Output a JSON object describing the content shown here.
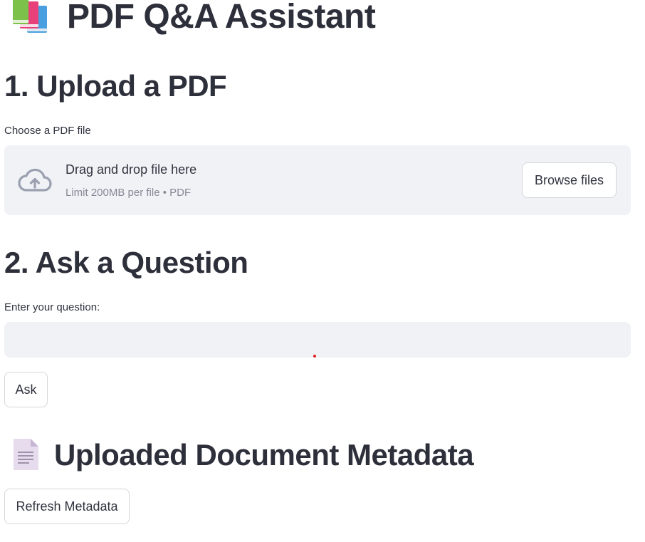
{
  "header": {
    "title": "PDF Q&A Assistant",
    "icon": "books-icon"
  },
  "upload": {
    "heading": "1. Upload a PDF",
    "label": "Choose a PDF file",
    "drop_text": "Drag and drop file here",
    "limit_text": "Limit 200MB per file • PDF",
    "browse_label": "Browse files",
    "icon": "cloud-upload-icon"
  },
  "question": {
    "heading": "2. Ask a Question",
    "label": "Enter your question:",
    "value": "",
    "ask_label": "Ask"
  },
  "metadata": {
    "heading": "Uploaded Document Metadata",
    "icon": "document-icon",
    "refresh_label": "Refresh Metadata"
  }
}
